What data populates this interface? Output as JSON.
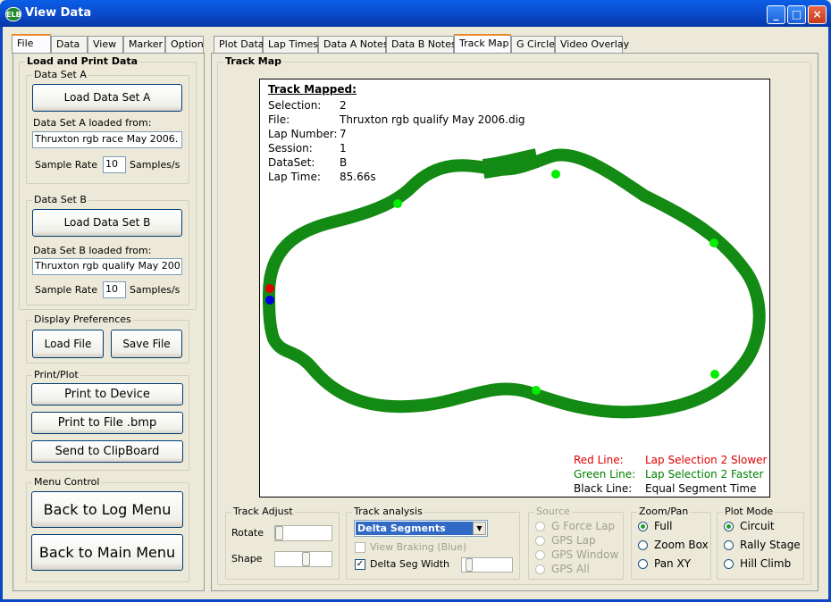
{
  "window": {
    "title": "View Data",
    "app_icon": "ELB",
    "min": "_",
    "max": "□",
    "close": "×"
  },
  "left_tabs": [
    "File",
    "Data",
    "View",
    "Marker",
    "Option"
  ],
  "right_tabs": [
    "Plot Data",
    "Lap Times",
    "Data A Notes",
    "Data B Notes",
    "Track Map",
    "G Circle",
    "Video Overlay"
  ],
  "load_print": {
    "title": "Load and Print Data",
    "set_a": {
      "title": "Data Set A",
      "button": "Load Data Set A",
      "loaded_label": "Data Set A loaded from:",
      "loaded_value": "Thruxton rgb race May 2006.",
      "rate_label": "Sample Rate",
      "rate_value": "10",
      "rate_unit": "Samples/s"
    },
    "set_b": {
      "title": "Data Set B",
      "button": "Load Data Set B",
      "loaded_label": "Data Set B loaded from:",
      "loaded_value": "Thruxton rgb qualify May 200",
      "rate_label": "Sample Rate",
      "rate_value": "10",
      "rate_unit": "Samples/s"
    }
  },
  "display_prefs": {
    "title": "Display Preferences",
    "load": "Load File",
    "save": "Save File"
  },
  "print_plot": {
    "title": "Print/Plot",
    "device": "Print to Device",
    "file": "Print to File .bmp",
    "clipboard": "Send to ClipBoard"
  },
  "menu_control": {
    "title": "Menu Control",
    "log": "Back to Log Menu",
    "main": "Back to Main Menu"
  },
  "track_map": {
    "title": "Track Map",
    "info_header": "Track Mapped:",
    "info": [
      {
        "k": "Selection:",
        "v": "2"
      },
      {
        "k": "File:",
        "v": "Thruxton rgb qualify May 2006.dig"
      },
      {
        "k": "Lap Number:",
        "v": "7"
      },
      {
        "k": "Session:",
        "v": "1"
      },
      {
        "k": "DataSet:",
        "v": "B"
      },
      {
        "k": "Lap Time:",
        "v": "85.66s"
      }
    ],
    "legend": [
      {
        "k": "Red Line:",
        "v": "Lap Selection 2 Slower",
        "color": "#e00000"
      },
      {
        "k": "Green Line:",
        "v": "Lap Selection 2 Faster",
        "color": "#008000"
      },
      {
        "k": "Black Line:",
        "v": "Equal Segment Time",
        "color": "#000000"
      }
    ],
    "colors": {
      "track": "#138a13",
      "marker": "#00ee00",
      "red_dot": "#e00000",
      "blue_dot": "#0000dd"
    }
  },
  "track_adjust": {
    "title": "Track Adjust",
    "rotate": "Rotate",
    "shape": "Shape",
    "rotate_level": 0.0,
    "shape_level": 0.55
  },
  "track_analysis": {
    "title": "Track analysis",
    "select": "Delta Segments",
    "braking": "View Braking (Blue)",
    "delta_width": "Delta Seg Width",
    "delta_checked": true,
    "braking_checked": false
  },
  "source": {
    "title": "Source",
    "options": [
      "G Force Lap",
      "GPS Lap",
      "GPS Window",
      "GPS All"
    ]
  },
  "zoom_pan": {
    "title": "Zoom/Pan",
    "options": [
      "Full",
      "Zoom Box",
      "Pan XY"
    ],
    "selected": 0
  },
  "plot_mode": {
    "title": "Plot Mode",
    "options": [
      "Circuit",
      "Rally Stage",
      "Hill Climb"
    ],
    "selected": 0
  }
}
